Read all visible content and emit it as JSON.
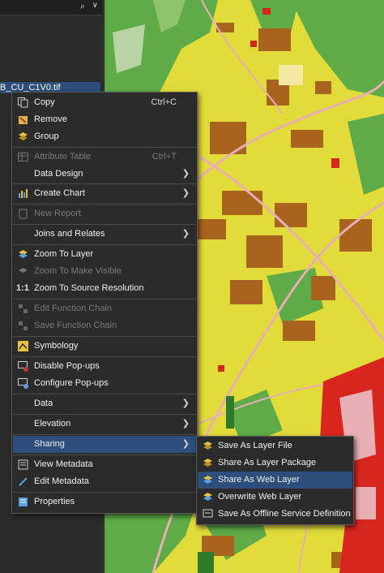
{
  "contents_pane": {
    "layer_name": "B_CU_C1V0.tif",
    "search_icon": "search-icon",
    "dropdown_icon": "chevron-down-icon"
  },
  "context_menu": {
    "items": [
      {
        "label": "Copy",
        "shortcut": "Ctrl+C",
        "icon": "copy-icon",
        "enabled": true
      },
      {
        "label": "Remove",
        "icon": "remove-icon",
        "enabled": true
      },
      {
        "label": "Group",
        "icon": "group-layers-icon",
        "enabled": true
      },
      {
        "label": "Attribute Table",
        "shortcut": "Ctrl+T",
        "icon": "table-icon",
        "enabled": false
      },
      {
        "label": "Data Design",
        "submenu": true,
        "enabled": true
      },
      {
        "label": "Create Chart",
        "icon": "chart-icon",
        "submenu": true,
        "enabled": true
      },
      {
        "label": "New Report",
        "icon": "report-icon",
        "enabled": false
      },
      {
        "label": "Joins and Relates",
        "submenu": true,
        "enabled": true
      },
      {
        "label": "Zoom To Layer",
        "icon": "zoom-to-layer-icon",
        "enabled": true
      },
      {
        "label": "Zoom To Make Visible",
        "icon": "zoom-visible-icon",
        "enabled": false
      },
      {
        "label": "Zoom To Source Resolution",
        "icon": "one-to-one-icon",
        "enabled": true
      },
      {
        "label": "Edit Function Chain",
        "icon": "function-chain-icon",
        "enabled": false
      },
      {
        "label": "Save Function Chain",
        "icon": "save-function-icon",
        "enabled": false
      },
      {
        "label": "Symbology",
        "icon": "symbology-icon",
        "enabled": true
      },
      {
        "label": "Disable Pop-ups",
        "icon": "disable-popups-icon",
        "enabled": true
      },
      {
        "label": "Configure Pop-ups",
        "icon": "configure-popups-icon",
        "enabled": true
      },
      {
        "label": "Data",
        "submenu": true,
        "enabled": true
      },
      {
        "label": "Elevation",
        "submenu": true,
        "enabled": true
      },
      {
        "label": "Sharing",
        "submenu": true,
        "enabled": true,
        "highlighted": true
      },
      {
        "label": "View Metadata",
        "icon": "view-metadata-icon",
        "enabled": true
      },
      {
        "label": "Edit Metadata",
        "icon": "edit-metadata-icon",
        "enabled": true
      },
      {
        "label": "Properties",
        "icon": "properties-icon",
        "enabled": true
      }
    ]
  },
  "sharing_submenu": {
    "items": [
      {
        "label": "Save As Layer File",
        "icon": "layer-file-icon"
      },
      {
        "label": "Share As Layer Package",
        "icon": "layer-package-icon"
      },
      {
        "label": "Share As Web Layer",
        "icon": "web-layer-icon",
        "highlighted": true
      },
      {
        "label": "Overwrite Web Layer",
        "icon": "overwrite-web-layer-icon"
      },
      {
        "label": "Save As Offline Service Definition",
        "icon": "service-definition-icon"
      }
    ]
  },
  "colors": {
    "menu_bg": "#2b2b2b",
    "highlight": "#2d4d7a",
    "map_yellow": "#e2dc3a",
    "map_green": "#5eab48",
    "map_brown": "#a8631d",
    "map_red": "#d8261f",
    "map_pink": "#e8b0b4"
  }
}
